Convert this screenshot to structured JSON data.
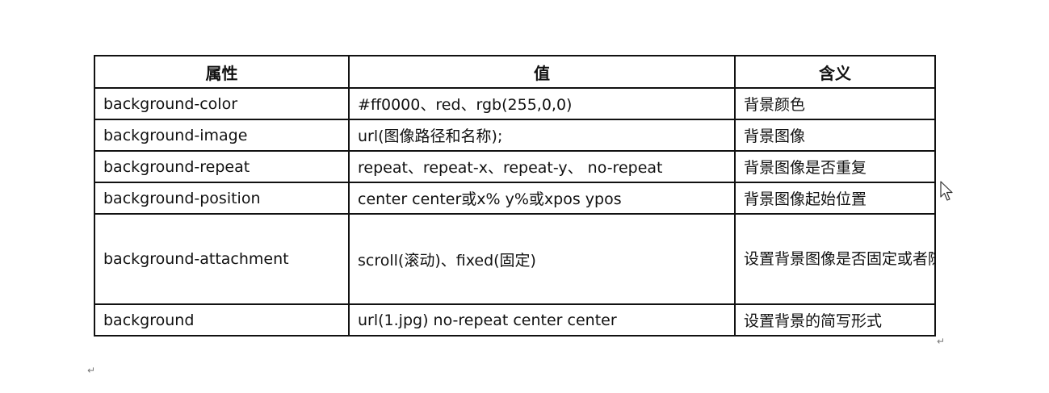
{
  "table": {
    "headers": [
      "属性",
      "值",
      "含义"
    ],
    "rows": [
      {
        "property": "background-color",
        "value": "#ff0000、red、rgb(255,0,0)",
        "meaning": "背景颜色"
      },
      {
        "property": "background-image",
        "value": "url(图像路径和名称);",
        "meaning": "背景图像"
      },
      {
        "property": "background-repeat",
        "value": "repeat、repeat-x、repeat-y、  no-repeat",
        "meaning": "背景图像是否重复"
      },
      {
        "property": "background-position",
        "value": "center center或x%  y%或xpos ypos",
        "meaning": "背景图像起始位置"
      },
      {
        "property": "background-attachment",
        "value": "scroll(滚动)、fixed(固定)",
        "meaning": "设置背景图像是否固定或者随着页面的其余部分滚动。"
      },
      {
        "property": "background",
        "value": "url(1.jpg)  no-repeat  center center",
        "meaning": "设置背景的简写形式"
      }
    ]
  },
  "marks": {
    "paragraph_mark": "↵"
  },
  "icons": {
    "cursor": "mouse-pointer-icon"
  }
}
